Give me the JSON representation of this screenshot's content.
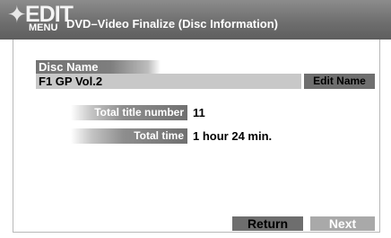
{
  "header": {
    "logo_icon": "star-icon",
    "logo_text": "EDIT",
    "logo_subtext": "MENU",
    "title": "DVD–Video Finalize (Disc Information)"
  },
  "disc": {
    "label": "Disc Name",
    "value": "F1 GP Vol.2",
    "edit_button": "Edit Name"
  },
  "info": {
    "title_number_label": "Total title number",
    "title_number_value": "11",
    "time_label": "Total time",
    "time_value": "1 hour 24 min."
  },
  "footer": {
    "return_label": "Return",
    "next_label": "Next"
  },
  "colors": {
    "header": "#6f6f6f",
    "button_dark": "#6e6e6e",
    "button_light": "#a9a9a9",
    "value_bar": "#c8c8c8"
  }
}
